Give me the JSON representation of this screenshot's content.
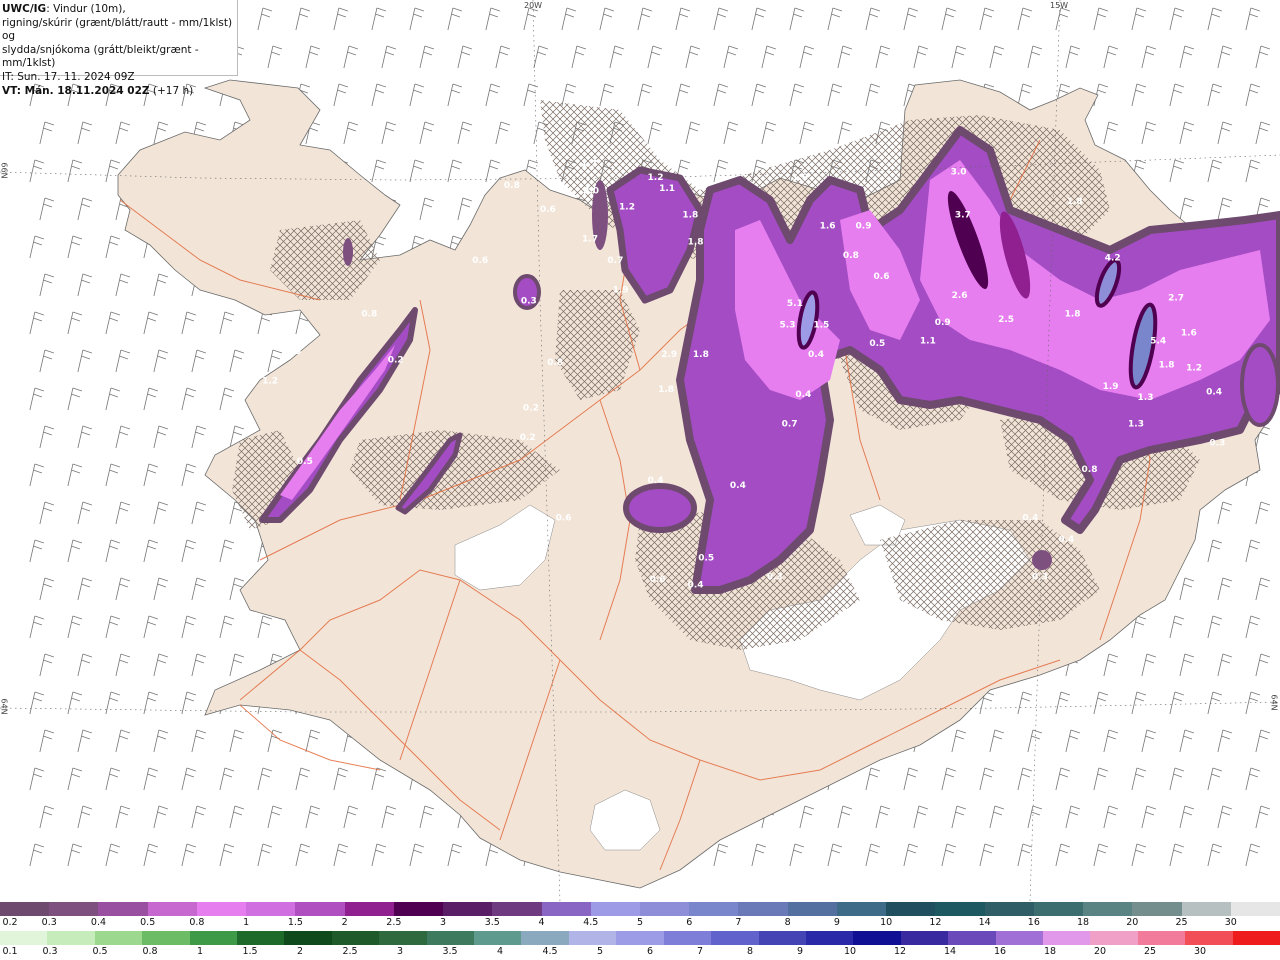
{
  "info": {
    "line1_bold": "UWC/IG",
    "line1_rest": ": Vindur (10m),",
    "line2": "rigning/skúrir (grænt/blátt/rautt - mm/1klst) og",
    "line3": "slydda/snjókoma (grátt/bleikt/grænt - mm/1klst)",
    "line4": "IT: Sun. 17. 11. 2024 09Z",
    "line5_bold": "VT: Mán. 18.11.2024 02Z",
    "line5_rest": " (+17 h)"
  },
  "grid_labels": {
    "lon_20w": "20W",
    "lon_15w": "15W",
    "lat_66n": "66N",
    "lat_64n_left": "64N",
    "lat_64n_right": "64N"
  },
  "precip_labels": [
    {
      "text": "1.7",
      "lon": -19.47,
      "lat": 66.02
    },
    {
      "text": "2.0",
      "lon": -19.45,
      "lat": 65.92
    },
    {
      "text": "0.8",
      "lon": -20.2,
      "lat": 65.94
    },
    {
      "text": "0.6",
      "lon": -19.86,
      "lat": 65.85
    },
    {
      "text": "1.7",
      "lon": -19.46,
      "lat": 65.74
    },
    {
      "text": "0.7",
      "lon": -19.22,
      "lat": 65.66
    },
    {
      "text": "1.2",
      "lon": -19.11,
      "lat": 65.86
    },
    {
      "text": "1.2",
      "lon": -18.84,
      "lat": 65.97
    },
    {
      "text": "1.1",
      "lon": -18.73,
      "lat": 65.93
    },
    {
      "text": "1.8",
      "lon": -18.51,
      "lat": 65.83
    },
    {
      "text": "1.8",
      "lon": -18.46,
      "lat": 65.73
    },
    {
      "text": "1.0",
      "lon": -17.47,
      "lat": 65.97
    },
    {
      "text": "1.6",
      "lon": -17.21,
      "lat": 65.79
    },
    {
      "text": "0.9",
      "lon": -16.87,
      "lat": 65.79
    },
    {
      "text": "0.8",
      "lon": -16.99,
      "lat": 65.68
    },
    {
      "text": "0.6",
      "lon": -16.7,
      "lat": 65.6
    },
    {
      "text": "3.0",
      "lon": -15.97,
      "lat": 65.99
    },
    {
      "text": "3.7",
      "lon": -15.93,
      "lat": 65.83
    },
    {
      "text": "1.8",
      "lon": -14.87,
      "lat": 65.88
    },
    {
      "text": "4.2",
      "lon": -14.51,
      "lat": 65.67
    },
    {
      "text": "2.6",
      "lon": -15.96,
      "lat": 65.53
    },
    {
      "text": "2.5",
      "lon": -15.52,
      "lat": 65.44
    },
    {
      "text": "1.8",
      "lon": -14.89,
      "lat": 65.46
    },
    {
      "text": "2.7",
      "lon": -13.91,
      "lat": 65.52
    },
    {
      "text": "1.6",
      "lon": -13.79,
      "lat": 65.39
    },
    {
      "text": "5.4",
      "lon": -14.08,
      "lat": 65.36
    },
    {
      "text": "1.8",
      "lon": -14.0,
      "lat": 65.27
    },
    {
      "text": "1.2",
      "lon": -13.74,
      "lat": 65.26
    },
    {
      "text": "0.4",
      "lon": -13.55,
      "lat": 65.17
    },
    {
      "text": "1.9",
      "lon": -14.53,
      "lat": 65.19
    },
    {
      "text": "1.3",
      "lon": -14.2,
      "lat": 65.15
    },
    {
      "text": "1.3",
      "lon": -14.29,
      "lat": 65.05
    },
    {
      "text": "0.3",
      "lon": -13.52,
      "lat": 64.98
    },
    {
      "text": "0.8",
      "lon": -14.73,
      "lat": 64.88
    },
    {
      "text": "0.4",
      "lon": -15.29,
      "lat": 64.7
    },
    {
      "text": "0.4",
      "lon": -14.95,
      "lat": 64.62
    },
    {
      "text": "0.3",
      "lon": -15.2,
      "lat": 64.48
    },
    {
      "text": "5.1",
      "lon": -17.52,
      "lat": 65.5
    },
    {
      "text": "5.3",
      "lon": -17.59,
      "lat": 65.42
    },
    {
      "text": "1.5",
      "lon": -17.27,
      "lat": 65.42
    },
    {
      "text": "0.4",
      "lon": -17.32,
      "lat": 65.31
    },
    {
      "text": "0.5",
      "lon": -16.74,
      "lat": 65.35
    },
    {
      "text": "1.1",
      "lon": -16.26,
      "lat": 65.36
    },
    {
      "text": "0.9",
      "lon": -16.12,
      "lat": 65.43
    },
    {
      "text": "1.9",
      "lon": -19.17,
      "lat": 65.55
    },
    {
      "text": "2.9",
      "lon": -18.71,
      "lat": 65.31
    },
    {
      "text": "1.8",
      "lon": -18.41,
      "lat": 65.31
    },
    {
      "text": "1.8",
      "lon": -18.74,
      "lat": 65.18
    },
    {
      "text": "0.8",
      "lon": -19.79,
      "lat": 65.28
    },
    {
      "text": "0.4",
      "lon": -17.44,
      "lat": 65.16
    },
    {
      "text": "0.7",
      "lon": -17.57,
      "lat": 65.05
    },
    {
      "text": "0.2",
      "lon": -20.02,
      "lat": 65.11
    },
    {
      "text": "0.2",
      "lon": -20.05,
      "lat": 65.0
    },
    {
      "text": "0.4",
      "lon": -18.84,
      "lat": 64.84
    },
    {
      "text": "0.4",
      "lon": -18.06,
      "lat": 64.82
    },
    {
      "text": "0.6",
      "lon": -19.71,
      "lat": 64.7
    },
    {
      "text": "0.6",
      "lon": -20.06,
      "lat": 64.62
    },
    {
      "text": "0.5",
      "lon": -18.36,
      "lat": 64.55
    },
    {
      "text": "0.6",
      "lon": -18.82,
      "lat": 64.47
    },
    {
      "text": "0.4",
      "lon": -18.46,
      "lat": 64.45
    },
    {
      "text": "0.3",
      "lon": -17.71,
      "lat": 64.48
    },
    {
      "text": "0.6",
      "lon": -20.5,
      "lat": 65.66
    },
    {
      "text": "0.3",
      "lon": -20.04,
      "lat": 65.51
    },
    {
      "text": "0.8",
      "lon": -21.55,
      "lat": 65.46
    },
    {
      "text": "0.2",
      "lon": -21.3,
      "lat": 65.29
    },
    {
      "text": "1.2",
      "lon": -22.49,
      "lat": 65.21
    },
    {
      "text": "1.5",
      "lon": -22.27,
      "lat": 65.32
    },
    {
      "text": "0.4",
      "lon": -23.16,
      "lat": 65.2
    },
    {
      "text": "1.8",
      "lon": -23.21,
      "lat": 64.98
    },
    {
      "text": "1.6",
      "lon": -23.48,
      "lat": 64.88
    },
    {
      "text": "0.5",
      "lon": -22.16,
      "lat": 64.91
    }
  ],
  "legend": {
    "snow_colors": [
      "#6e4a6e",
      "#7e5080",
      "#9a50a0",
      "#c668d0",
      "#e77ef0",
      "#d070e0",
      "#b050c0",
      "#902090",
      "#500050",
      "#5a1e66",
      "#6e3a80",
      "#8a66c4",
      "#9d9ae6",
      "#8e8ed8",
      "#7a86cc",
      "#6a7ab8",
      "#5470a0",
      "#3e6c88",
      "#204f60",
      "#1e5860",
      "#305e66",
      "#3c6e70",
      "#5a8484",
      "#748e8e",
      "#b6c0c0",
      "#e6e6e6"
    ],
    "snow_labels": [
      "0.2",
      "0.3",
      "0.4",
      "0.5",
      "0.8",
      "1",
      "1.5",
      "2",
      "2.5",
      "3",
      "3.5",
      "4",
      "4.5",
      "5",
      "6",
      "7",
      "8",
      "9",
      "10",
      "12",
      "14",
      "16",
      "18",
      "20",
      "25",
      "30"
    ],
    "rain_colors": [
      "#e0f5da",
      "#c6ecbc",
      "#9cd88e",
      "#6cbc66",
      "#3e9a46",
      "#1e6a2a",
      "#0e4a1c",
      "#1e5a2a",
      "#2e6a3e",
      "#3e7a5e",
      "#5e9a8e",
      "#8aa8be",
      "#b0b4e6",
      "#9c9ce6",
      "#7e7ed8",
      "#6262cc",
      "#4444b4",
      "#2a2aa8",
      "#101094",
      "#3a2aa0",
      "#6a4aba",
      "#a070d6",
      "#e298ea",
      "#f0a0c6",
      "#f27a9a",
      "#f24e58",
      "#ee1c1c"
    ],
    "rain_labels": [
      "0.1",
      "0.3",
      "0.5",
      "0.8",
      "1",
      "1.5",
      "2",
      "2.5",
      "3",
      "3.5",
      "4",
      "4.5",
      "5",
      "6",
      "7",
      "8",
      "9",
      "10",
      "12",
      "14",
      "16",
      "18",
      "20",
      "25",
      "30"
    ]
  }
}
